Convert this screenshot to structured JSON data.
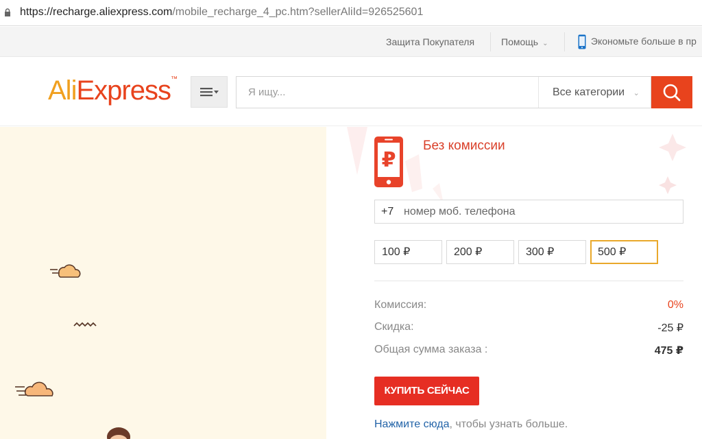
{
  "browser": {
    "url_host": "https://recharge.aliexpress.com",
    "url_path": "/mobile_recharge_4_pc.htm?sellerAliId=926525601"
  },
  "topbar": {
    "buyer_protection": "Защита Покупателя",
    "help": "Помощь",
    "app_promo": "Экономьте больше в пр"
  },
  "header": {
    "logo_part1": "Ali",
    "logo_part2": "Express",
    "logo_tm": "™",
    "search_placeholder": "Я ищу...",
    "category": "Все категории"
  },
  "recharge": {
    "no_commission": "Без комиссии",
    "phone_prefix": "+7",
    "phone_placeholder": "номер моб. телефона",
    "amounts": [
      "100 ₽",
      "200 ₽",
      "300 ₽",
      "500 ₽"
    ],
    "selected_amount": "500 ₽",
    "commission_label": "Комиссия:",
    "commission_value": "0%",
    "discount_label": "Скидка:",
    "discount_value": "-25 ₽",
    "total_label": "Общая сумма заказа :",
    "total_value": "475 ₽",
    "buy_button": "КУПИТЬ СЕЙЧАС",
    "more_link": "Нажмите сюда",
    "more_text": ", чтобы узнать больше."
  },
  "colors": {
    "accent": "#e8431d",
    "buy_button": "#e62e23",
    "selected_border": "#e9a82a",
    "link": "#2364a8"
  }
}
